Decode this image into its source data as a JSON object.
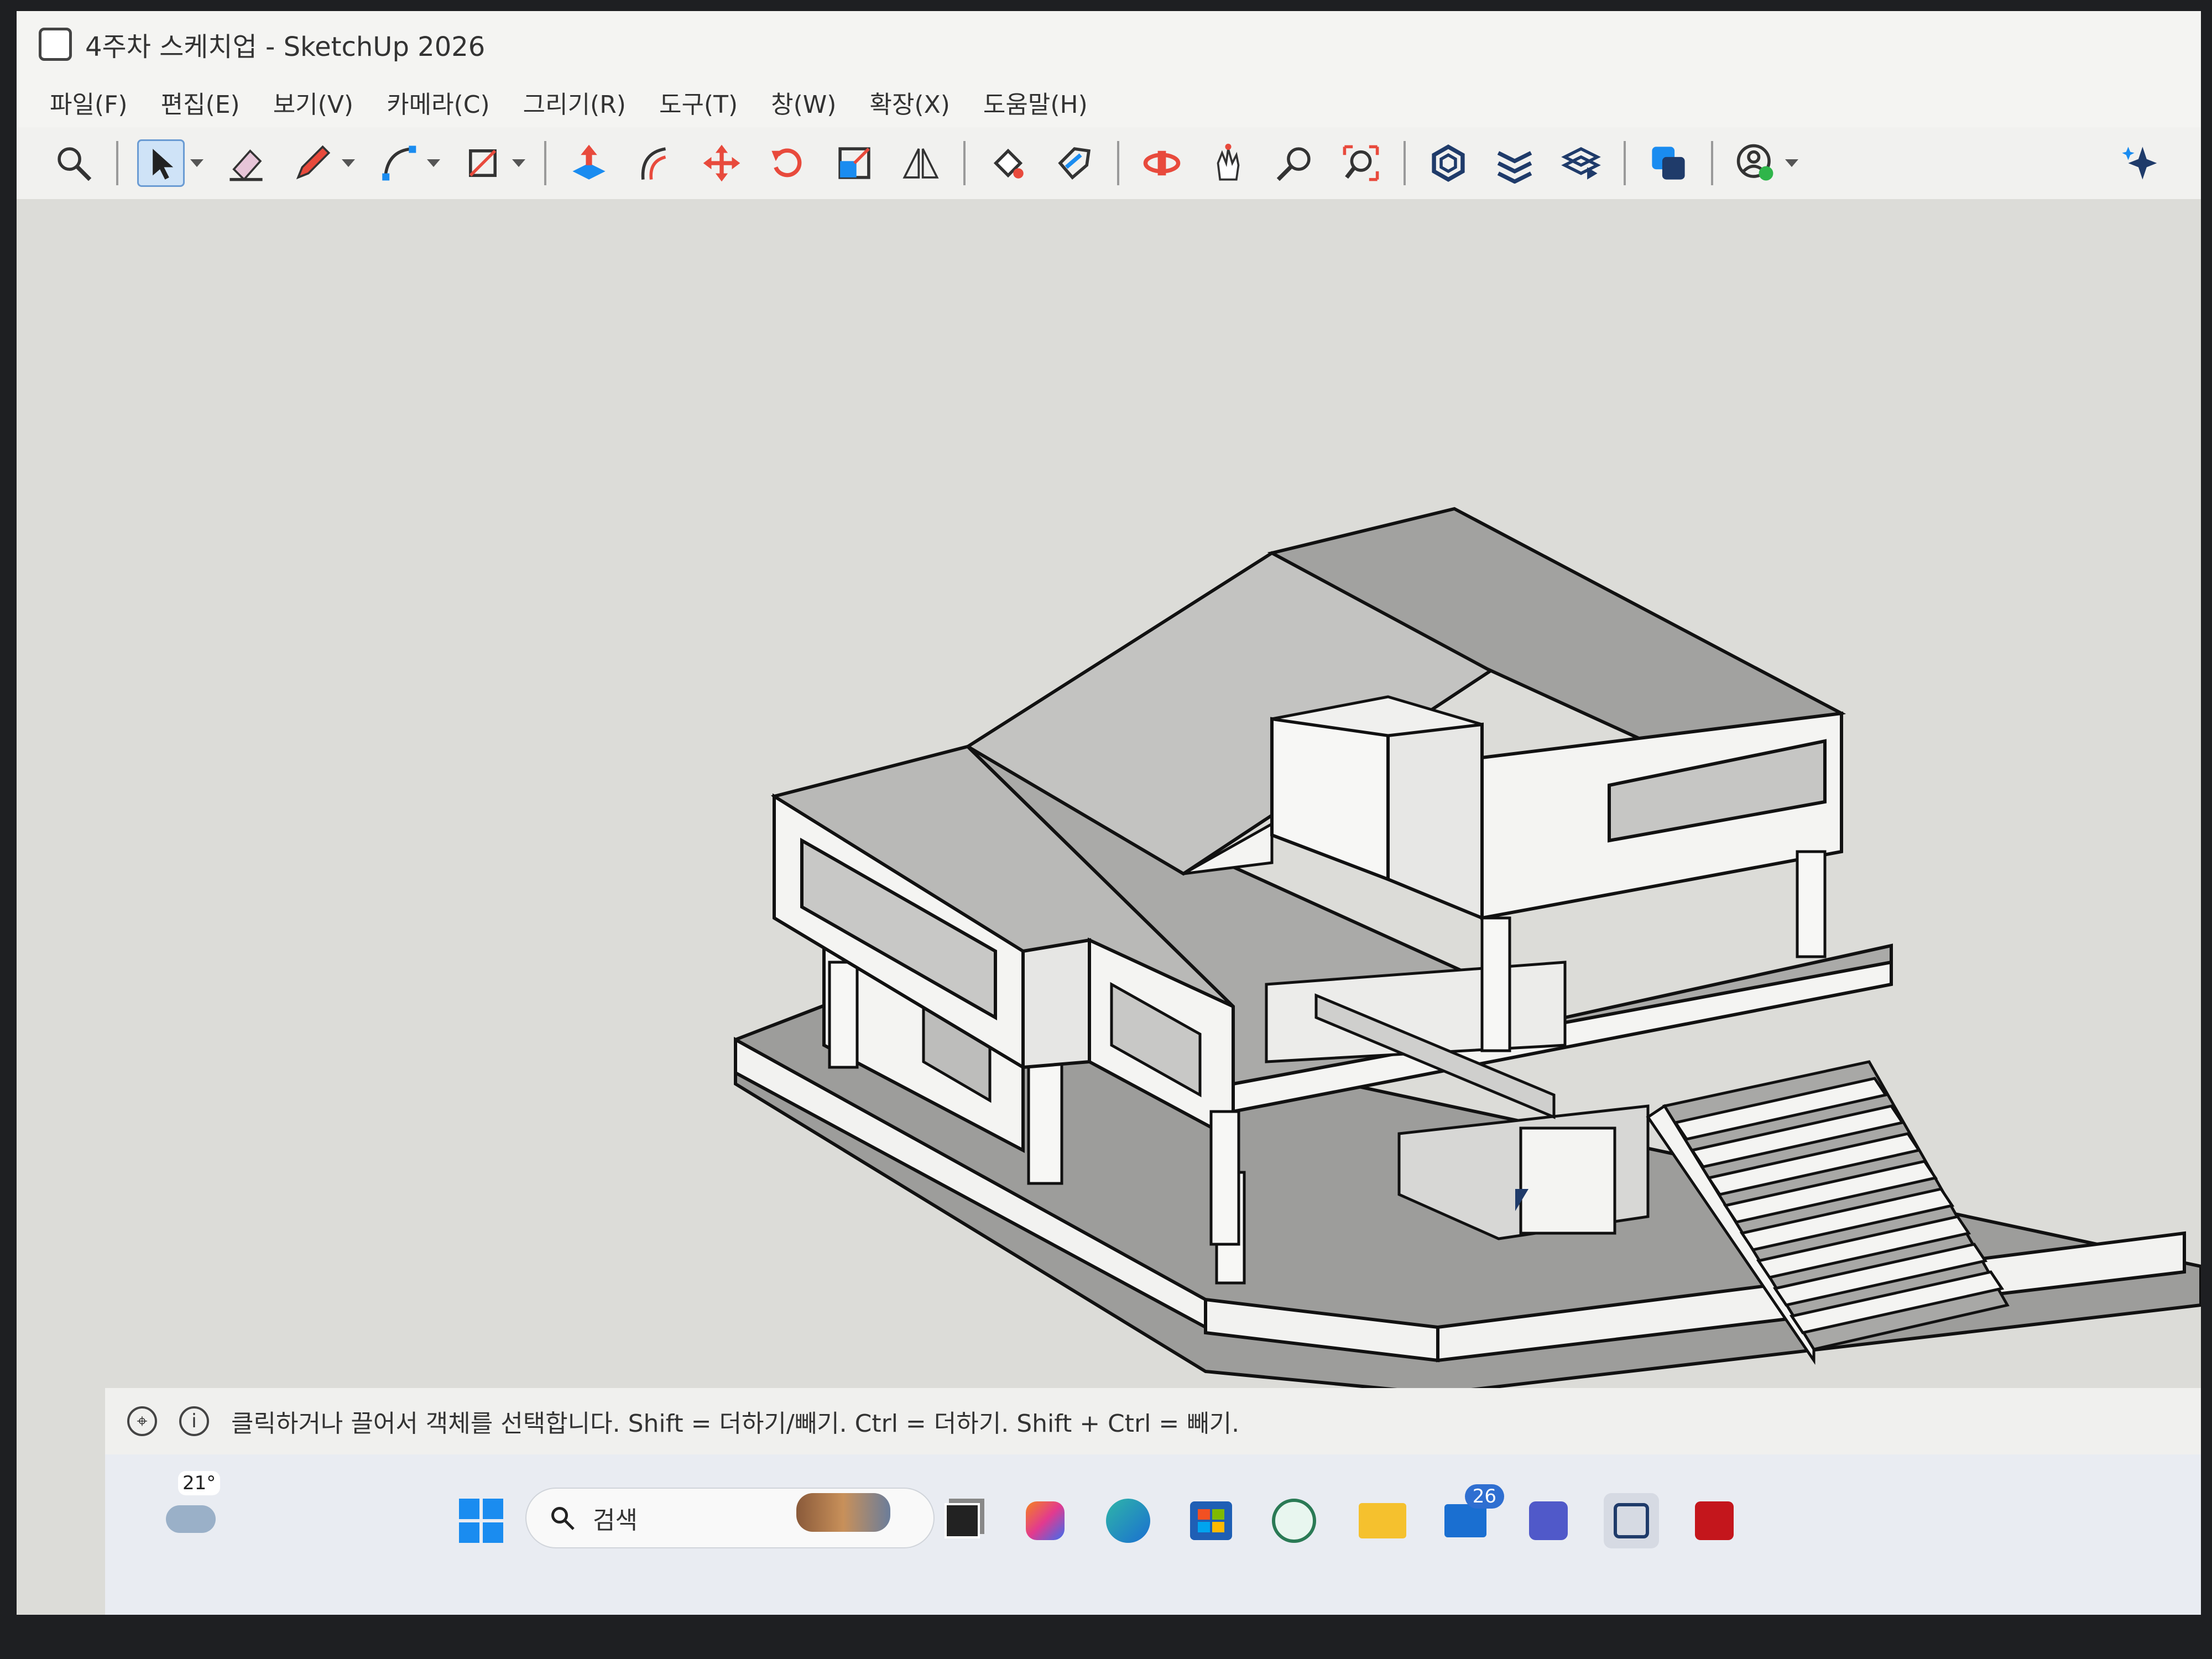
{
  "window": {
    "title": "4주차 스케치업 - SketchUp 2026"
  },
  "menu": [
    "파일(F)",
    "편집(E)",
    "보기(V)",
    "카메라(C)",
    "그리기(R)",
    "도구(T)",
    "창(W)",
    "확장(X)",
    "도움말(H)"
  ],
  "toolbar": {
    "tools": [
      "search-icon",
      "select-icon",
      "eraser-icon",
      "pencil-icon",
      "arc-icon",
      "rectangle-icon",
      "push-pull-icon",
      "offset-icon",
      "move-icon",
      "rotate-icon",
      "scale-icon",
      "flip-icon",
      "paint-bucket-icon",
      "tag-icon",
      "orbit-icon",
      "pan-icon",
      "zoom-icon",
      "zoom-extents-icon",
      "components-icon",
      "layers-icon",
      "scenes-icon",
      "styles-icon",
      "account-icon",
      "ai-assistant-icon"
    ]
  },
  "status": {
    "text": "클릭하거나 끌어서 객체를 선택합니다. Shift = 더하기/빼기. Ctrl = 더하기. Shift + Ctrl = 빼기."
  },
  "taskbar": {
    "weather_temp": "21°",
    "search_placeholder": "검색",
    "notification_count": "26"
  },
  "colors": {
    "accent": "#1a8cf0",
    "viewport_bg": "#dcdcd8"
  }
}
